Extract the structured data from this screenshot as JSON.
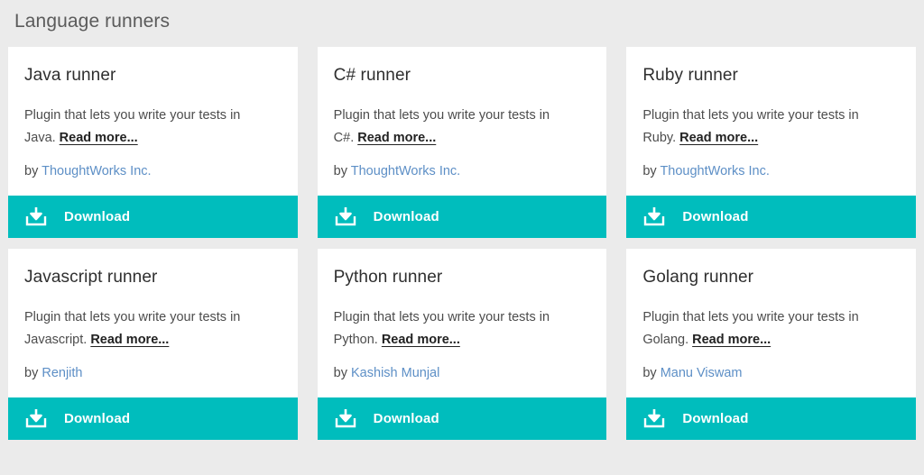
{
  "page": {
    "title": "Language runners",
    "background_color": "#ebebeb",
    "accent_color": "#00bdbd",
    "link_color": "#5d8fc6"
  },
  "common": {
    "download_label": "Download",
    "download_icon": "download-tray-icon",
    "read_more_label": "Read more...",
    "by_label": "by"
  },
  "cards": [
    {
      "title": "Java runner",
      "description": "Plugin that lets you write your tests in Java.",
      "read_more": "Read more...",
      "by": "by",
      "author": "ThoughtWorks Inc.",
      "download": "Download"
    },
    {
      "title": "C# runner",
      "description": "Plugin that lets you write your tests in C#.",
      "read_more": "Read more...",
      "by": "by",
      "author": "ThoughtWorks Inc.",
      "download": "Download"
    },
    {
      "title": "Ruby runner",
      "description": "Plugin that lets you write your tests in Ruby.",
      "read_more": "Read more...",
      "by": "by",
      "author": "ThoughtWorks Inc.",
      "download": "Download"
    },
    {
      "title": "Javascript runner",
      "description": "Plugin that lets you write your tests in Javascript.",
      "read_more": "Read more...",
      "by": "by",
      "author": "Renjith",
      "download": "Download"
    },
    {
      "title": "Python runner",
      "description": "Plugin that lets you write your tests in Python.",
      "read_more": "Read more...",
      "by": "by",
      "author": "Kashish Munjal",
      "download": "Download"
    },
    {
      "title": "Golang runner",
      "description": "Plugin that lets you write your tests in Golang.",
      "read_more": "Read more...",
      "by": "by",
      "author": "Manu Viswam",
      "download": "Download"
    }
  ]
}
